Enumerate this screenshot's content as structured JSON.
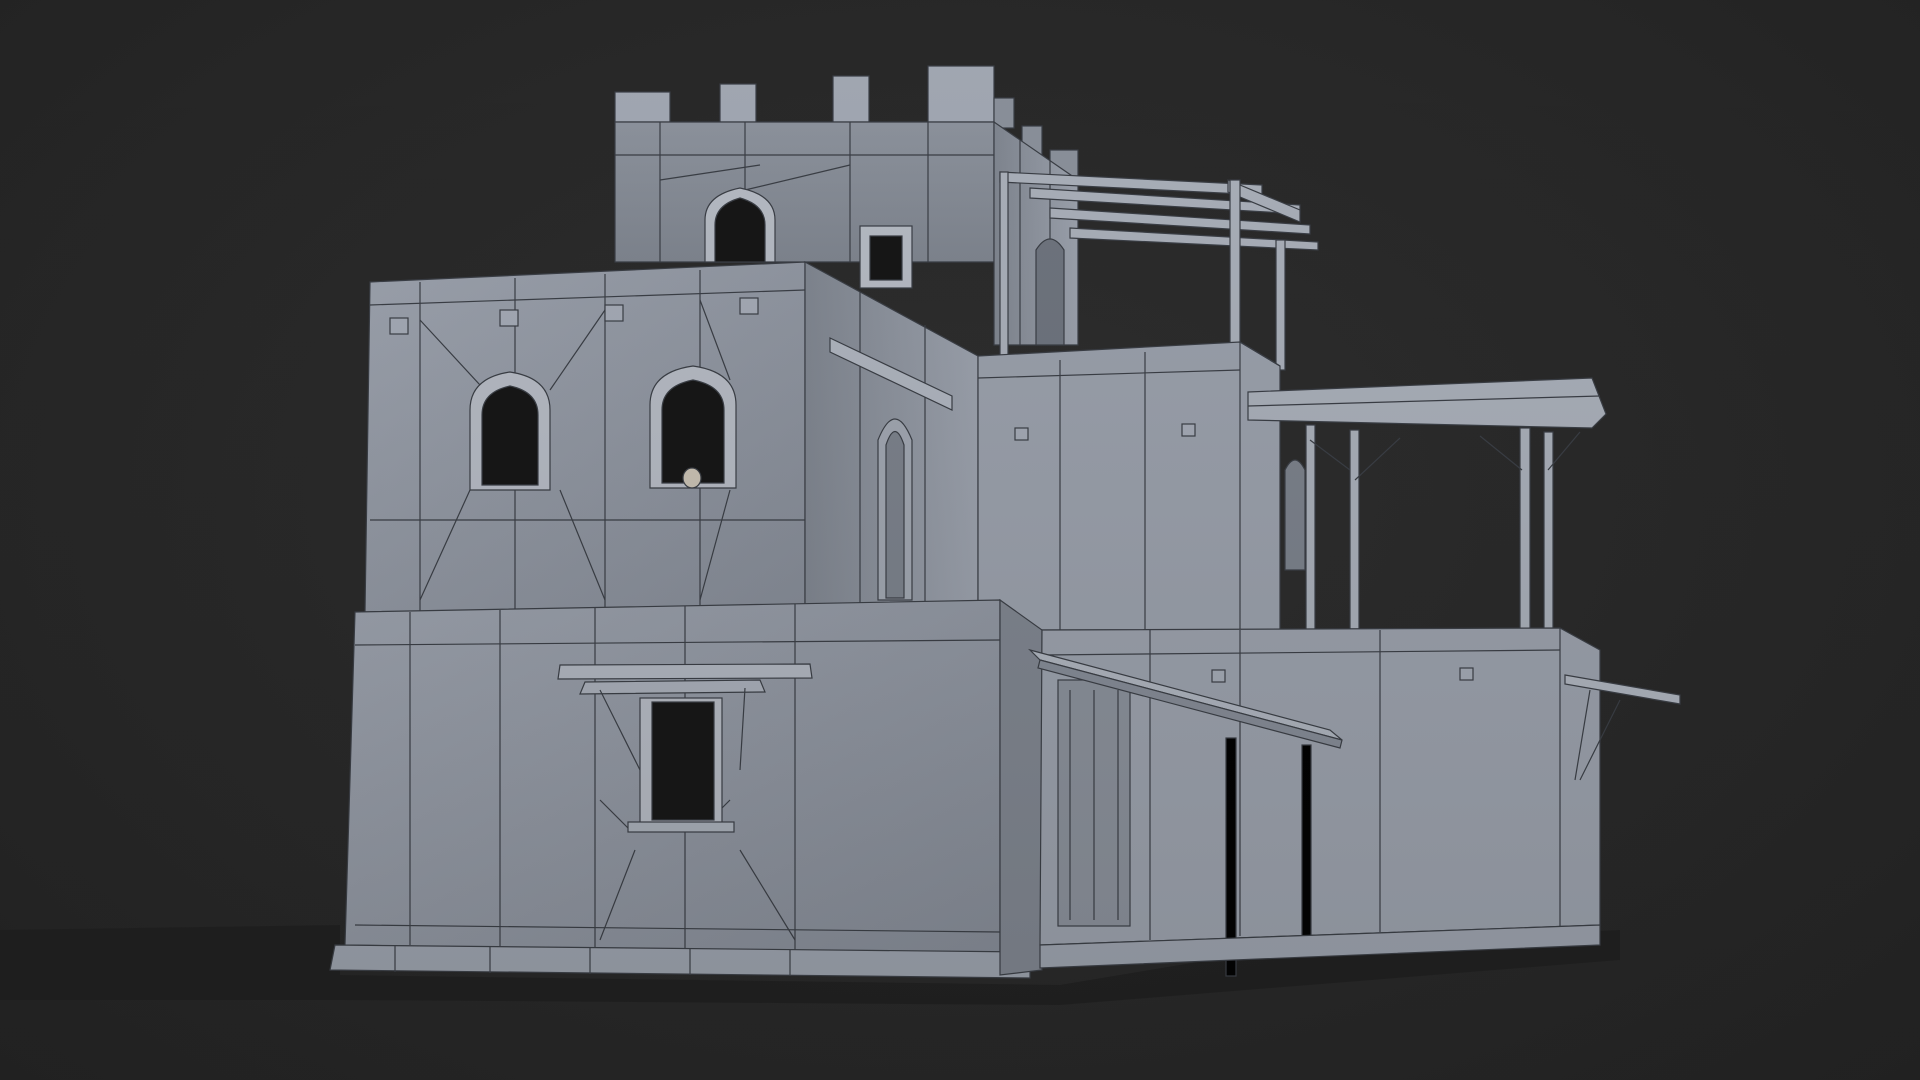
{
  "scene": {
    "kind": "3d-clay-render",
    "subject": "adobe-house-with-tower",
    "background_color": "#282828",
    "clay_color": "#8f95a0",
    "clay_light": "#a4aab5",
    "clay_dark": "#6b717b",
    "wire_color": "#3a3e45",
    "opening_color": "#161616",
    "shadow_color": "#1c1c1c"
  }
}
